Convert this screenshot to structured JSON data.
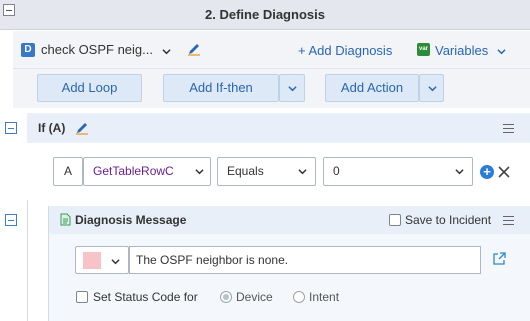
{
  "section": {
    "title": "2. Define Diagnosis"
  },
  "diagnosis": {
    "name": "check OSPF neig...",
    "add_diagnosis": "+ Add Diagnosis",
    "variables_badge": "var",
    "variables_label": "Variables"
  },
  "toolbar": {
    "add_loop": "Add Loop",
    "add_if_then": "Add If-then",
    "add_action": "Add Action"
  },
  "if_block": {
    "label": "If (A)",
    "condition": {
      "letter": "A",
      "variable": "GetTableRowC",
      "operator": "Equals",
      "value": "0"
    }
  },
  "diag_message": {
    "title": "Diagnosis Message",
    "save_to_incident": "Save to Incident",
    "swatch_color": "#f8c3c6",
    "message": "The OSPF neighbor is none.",
    "set_status_code": "Set Status Code for",
    "option_device": "Device",
    "option_intent": "Intent"
  },
  "colors": {
    "accent": "#2a66b4",
    "header_bg": "#e4e8ee"
  }
}
